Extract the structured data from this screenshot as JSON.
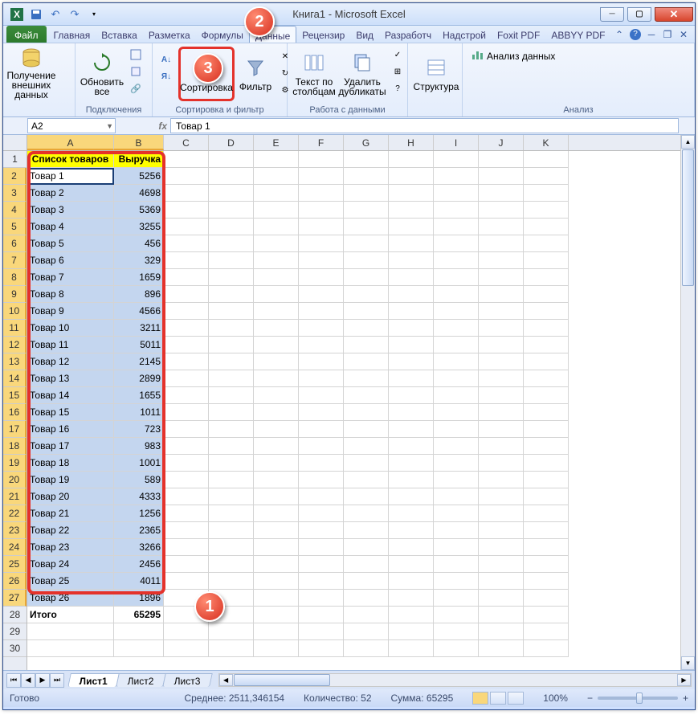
{
  "window": {
    "title": "Книга1  -  Microsoft Excel",
    "min": "—",
    "max": "🗖",
    "close": "✕"
  },
  "qat": {
    "excel": "X",
    "save": "💾",
    "undo": "↶",
    "redo": "↷",
    "new": "▦"
  },
  "tabs": {
    "file": "Файл",
    "items": [
      "Главная",
      "Вставка",
      "Разметка",
      "Формулы",
      "Данные",
      "Рецензир",
      "Вид",
      "Разработч",
      "Надстрой",
      "Foxit PDF",
      "ABBYY PDF"
    ],
    "active_index": 4,
    "help": "?"
  },
  "ribbon": {
    "group1": {
      "btn": "Получение внешних данных",
      "label": ""
    },
    "group2": {
      "btn": "Обновить все",
      "label": "Подключения",
      "conn": "Подключения",
      "prop": "Свойства",
      "links": "Изменить связи"
    },
    "group3": {
      "sort": "Сортировка",
      "filter": "Фильтр",
      "clear": "Очистить",
      "reapply": "Применить",
      "adv": "Дополнительно",
      "label": "Сортировка и фильтр"
    },
    "group4": {
      "t2c": "Текст по столбцам",
      "dup": "Удалить дубликаты",
      "label": "Работа с данными"
    },
    "group5": {
      "btn": "Структура",
      "label": ""
    },
    "group6": {
      "btn": "Анализ данных",
      "label": "Анализ"
    }
  },
  "name_box": "A2",
  "fx": "fx",
  "formula": "Товар 1",
  "columns": [
    "A",
    "B",
    "C",
    "D",
    "E",
    "F",
    "G",
    "H",
    "I",
    "J",
    "K"
  ],
  "headers": {
    "A": "Список товаров",
    "B": "Выручка"
  },
  "rows": [
    {
      "n": 1,
      "a": "Список товаров",
      "b": "Выручка",
      "hdr": true
    },
    {
      "n": 2,
      "a": "Товар 1",
      "b": "5256",
      "sel": true,
      "active": true
    },
    {
      "n": 3,
      "a": "Товар 2",
      "b": "4698",
      "sel": true
    },
    {
      "n": 4,
      "a": "Товар 3",
      "b": "5369",
      "sel": true
    },
    {
      "n": 5,
      "a": "Товар 4",
      "b": "3255",
      "sel": true
    },
    {
      "n": 6,
      "a": "Товар 5",
      "b": "456",
      "sel": true
    },
    {
      "n": 7,
      "a": "Товар 6",
      "b": "329",
      "sel": true
    },
    {
      "n": 8,
      "a": "Товар 7",
      "b": "1659",
      "sel": true
    },
    {
      "n": 9,
      "a": "Товар 8",
      "b": "896",
      "sel": true
    },
    {
      "n": 10,
      "a": "Товар 9",
      "b": "4566",
      "sel": true
    },
    {
      "n": 11,
      "a": "Товар 10",
      "b": "3211",
      "sel": true
    },
    {
      "n": 12,
      "a": "Товар 11",
      "b": "5011",
      "sel": true
    },
    {
      "n": 13,
      "a": "Товар 12",
      "b": "2145",
      "sel": true
    },
    {
      "n": 14,
      "a": "Товар 13",
      "b": "2899",
      "sel": true
    },
    {
      "n": 15,
      "a": "Товар 14",
      "b": "1655",
      "sel": true
    },
    {
      "n": 16,
      "a": "Товар 15",
      "b": "1011",
      "sel": true
    },
    {
      "n": 17,
      "a": "Товар 16",
      "b": "723",
      "sel": true
    },
    {
      "n": 18,
      "a": "Товар 17",
      "b": "983",
      "sel": true
    },
    {
      "n": 19,
      "a": "Товар 18",
      "b": "1001",
      "sel": true
    },
    {
      "n": 20,
      "a": "Товар 19",
      "b": "589",
      "sel": true
    },
    {
      "n": 21,
      "a": "Товар 20",
      "b": "4333",
      "sel": true
    },
    {
      "n": 22,
      "a": "Товар 21",
      "b": "1256",
      "sel": true
    },
    {
      "n": 23,
      "a": "Товар 22",
      "b": "2365",
      "sel": true
    },
    {
      "n": 24,
      "a": "Товар 23",
      "b": "3266",
      "sel": true
    },
    {
      "n": 25,
      "a": "Товар 24",
      "b": "2456",
      "sel": true
    },
    {
      "n": 26,
      "a": "Товар 25",
      "b": "4011",
      "sel": true
    },
    {
      "n": 27,
      "a": "Товар 26",
      "b": "1896",
      "sel": true
    },
    {
      "n": 28,
      "a": "Итого",
      "b": "65295",
      "bold": true
    },
    {
      "n": 29,
      "a": "",
      "b": ""
    },
    {
      "n": 30,
      "a": "",
      "b": ""
    }
  ],
  "sheets": {
    "items": [
      "Лист1",
      "Лист2",
      "Лист3"
    ],
    "active": 0
  },
  "status": {
    "ready": "Готово",
    "avg": "Среднее: 2511,346154",
    "count": "Количество: 52",
    "sum": "Сумма: 65295",
    "zoom": "100%",
    "minus": "−",
    "plus": "+"
  },
  "callouts": {
    "c1": "1",
    "c2": "2",
    "c3": "3"
  }
}
